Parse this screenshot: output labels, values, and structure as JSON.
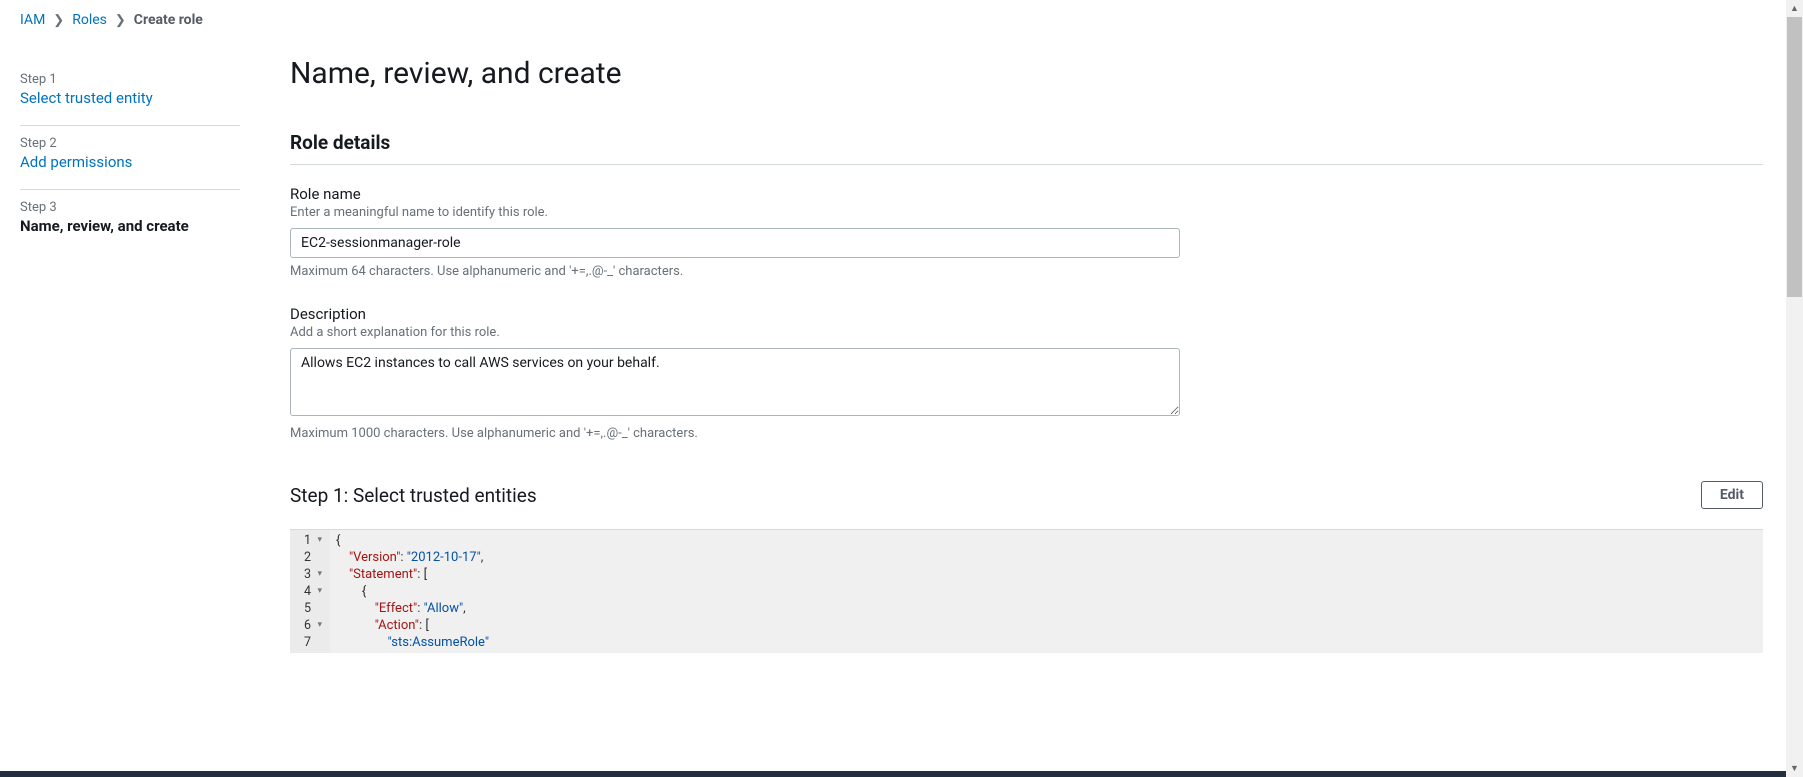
{
  "breadcrumb": {
    "items": [
      {
        "label": "IAM",
        "link": true
      },
      {
        "label": "Roles",
        "link": true
      },
      {
        "label": "Create role",
        "link": false
      }
    ]
  },
  "steps": [
    {
      "num": "Step 1",
      "title": "Select trusted entity",
      "current": false
    },
    {
      "num": "Step 2",
      "title": "Add permissions",
      "current": false
    },
    {
      "num": "Step 3",
      "title": "Name, review, and create",
      "current": true
    }
  ],
  "page": {
    "title": "Name, review, and create",
    "role_details_heading": "Role details",
    "role_name": {
      "label": "Role name",
      "hint": "Enter a meaningful name to identify this role.",
      "value": "EC2-sessionmanager-role",
      "help": "Maximum 64 characters. Use alphanumeric and '+=,.@-_' characters."
    },
    "description": {
      "label": "Description",
      "hint": "Add a short explanation for this role.",
      "value": "Allows EC2 instances to call AWS services on your behalf.",
      "help": "Maximum 1000 characters. Use alphanumeric and '+=,.@-_' characters."
    },
    "trusted_entities": {
      "title": "Step 1: Select trusted entities",
      "edit_label": "Edit",
      "policy": {
        "Version": "2012-10-17",
        "Statement": [
          {
            "Effect": "Allow",
            "Action": [
              "sts:AssumeRole"
            ]
          }
        ]
      },
      "display_lines": [
        {
          "n": "1",
          "fold": true,
          "text_html": "<span class='tok-brace'>{</span>"
        },
        {
          "n": "2",
          "fold": false,
          "text_html": "    <span class='tok-key'>\"Version\"</span><span class='tok-punct'>:</span> <span class='tok-str'>\"2012-10-17\"</span><span class='tok-punct'>,</span>"
        },
        {
          "n": "3",
          "fold": true,
          "text_html": "    <span class='tok-key'>\"Statement\"</span><span class='tok-punct'>:</span> <span class='tok-bracket'>[</span>"
        },
        {
          "n": "4",
          "fold": true,
          "text_html": "        <span class='tok-brace'>{</span>"
        },
        {
          "n": "5",
          "fold": false,
          "text_html": "            <span class='tok-key'>\"Effect\"</span><span class='tok-punct'>:</span> <span class='tok-str'>\"Allow\"</span><span class='tok-punct'>,</span>"
        },
        {
          "n": "6",
          "fold": true,
          "text_html": "            <span class='tok-key'>\"Action\"</span><span class='tok-punct'>:</span> <span class='tok-bracket'>[</span>"
        },
        {
          "n": "7",
          "fold": false,
          "text_html": "                <span class='tok-str'>\"sts:AssumeRole\"</span>"
        }
      ]
    }
  }
}
